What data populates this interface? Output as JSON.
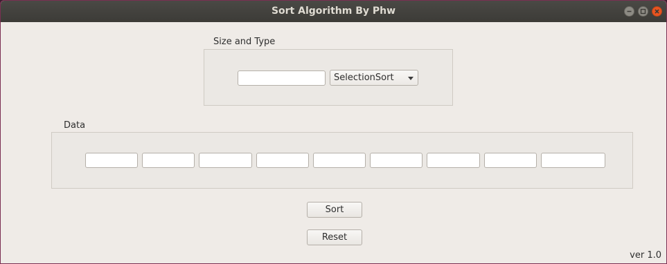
{
  "window": {
    "title": "Sort Algorithm By Phw"
  },
  "size_group": {
    "label": "Size and Type",
    "size_value": "",
    "algorithm_selected": "SelectionSort"
  },
  "data_group": {
    "label": "Data",
    "fields": [
      "",
      "",
      "",
      "",
      "",
      "",
      "",
      "",
      ""
    ]
  },
  "actions": {
    "sort_label": "Sort",
    "reset_label": "Reset"
  },
  "footer": {
    "version": "ver 1.0"
  },
  "colors": {
    "titlebar": "#3c3b37",
    "close_button": "#e95420",
    "window_bg": "#efebe7"
  }
}
